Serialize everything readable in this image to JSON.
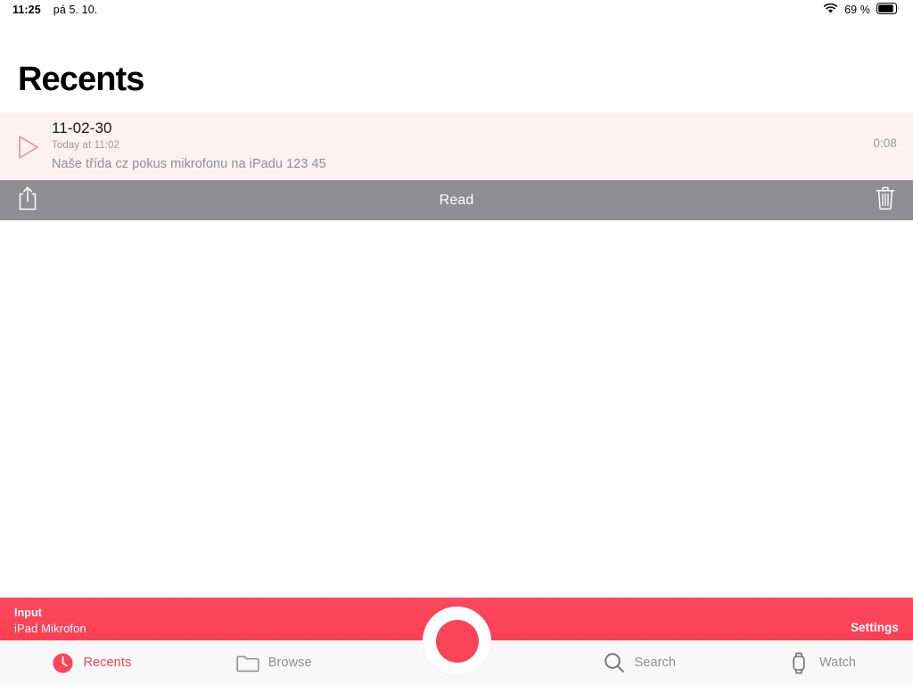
{
  "status_bar": {
    "time": "11:25",
    "date": "pá 5. 10.",
    "battery_percent": "69 %",
    "wifi_icon": "wifi-icon",
    "battery_icon": "battery-icon"
  },
  "header": {
    "title": "Recents"
  },
  "recording": {
    "play_icon": "play-triangle-icon",
    "title": "11-02-30",
    "subtitle": "Today at 11:02",
    "transcript": "Naše třída cz pokus mikrofonu na iPadu 123 45",
    "duration": "0:08",
    "selected_background": "#fdf1f2"
  },
  "action_bar": {
    "share_icon": "share-icon",
    "read_label": "Read",
    "delete_icon": "trash-icon",
    "background": "#8e8e93"
  },
  "input_bar": {
    "input_label": "Input",
    "input_value": "iPad Mikrofon",
    "settings_label": "Settings",
    "background": "#fb4359"
  },
  "record_button": {
    "name": "record-button",
    "color": "#fb4359"
  },
  "tab_bar": {
    "items": [
      {
        "label": "Recents",
        "icon": "clock-icon",
        "active": true
      },
      {
        "label": "Browse",
        "icon": "folder-icon",
        "active": false
      },
      {
        "label": "Search",
        "icon": "search-icon",
        "active": false
      },
      {
        "label": "Watch",
        "icon": "watch-icon",
        "active": false
      }
    ],
    "active_color": "#fb4359",
    "inactive_color": "#8e8e93"
  }
}
